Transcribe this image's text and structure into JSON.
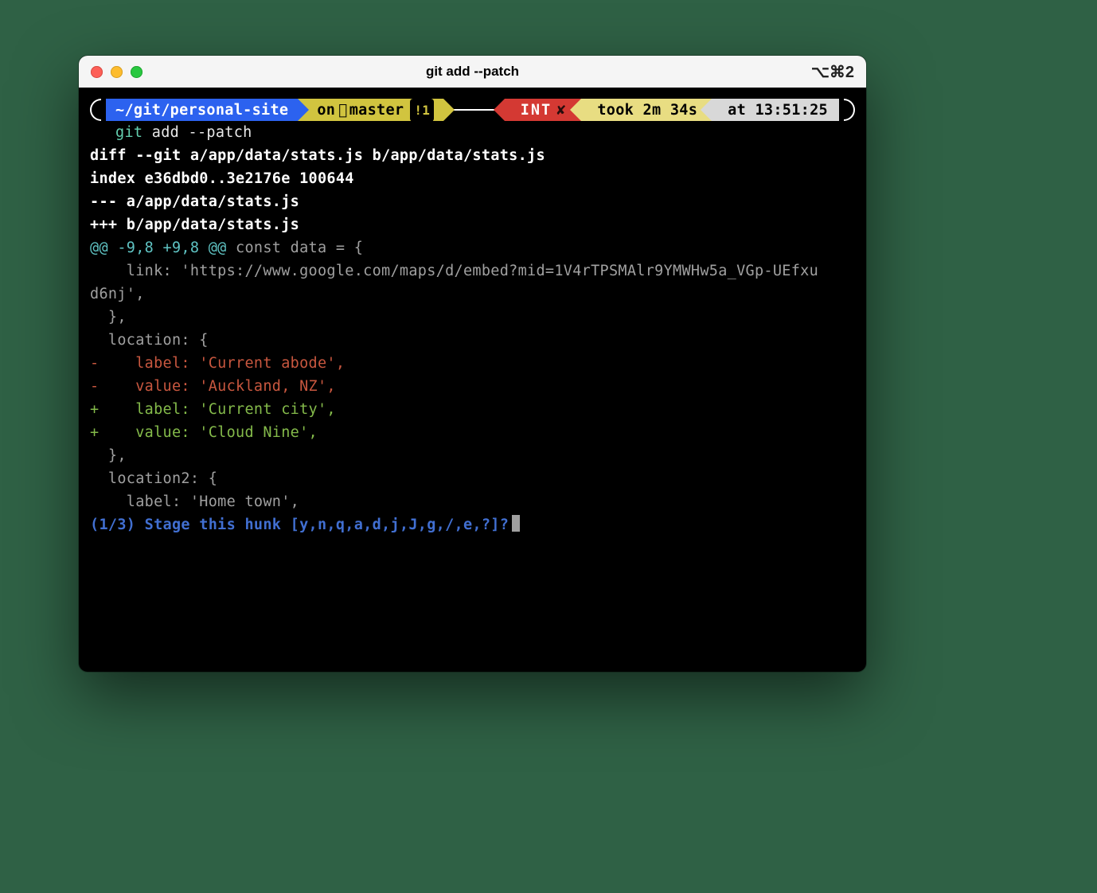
{
  "window": {
    "title": "git add --patch",
    "shortcut": "⌥⌘2"
  },
  "prompt": {
    "path_prefix": "~/git/",
    "path_repo": "personal-site",
    "branch_prefix": " on ",
    "branch_icon": "",
    "branch_name": "master",
    "branch_status": "!1",
    "int_label": "INT",
    "int_icon": "✘",
    "took_label": "took 2m 34s",
    "time_label": "at 13:51:25"
  },
  "command": {
    "git": "git",
    "rest": " add --patch"
  },
  "diff": {
    "header1": "diff --git a/app/data/stats.js b/app/data/stats.js",
    "header2": "index e36dbd0..3e2176e 100644",
    "header3": "--- a/app/data/stats.js",
    "header4": "+++ b/app/data/stats.js",
    "hunk_marker": "@@ -9,8 +9,8 @@",
    "hunk_context": " const data = {",
    "ctx1a": "    link: 'https://www.google.com/maps/d/embed?mid=1V4rTPSMAlr9YMWHw5a_VGp-UEfxu",
    "ctx1b": "d6nj',",
    "ctx2": "  },",
    "ctx3": "  location: {",
    "rem1": "-    label: 'Current abode',",
    "rem2": "-    value: 'Auckland, NZ',",
    "add1": "+    label: 'Current city',",
    "add2": "+    value: 'Cloud Nine',",
    "ctx4": "  },",
    "ctx5": "  location2: {",
    "ctx6": "    label: 'Home town',",
    "stage_prompt": "(1/3) Stage this hunk [y,n,q,a,d,j,J,g,/,e,?]?"
  }
}
